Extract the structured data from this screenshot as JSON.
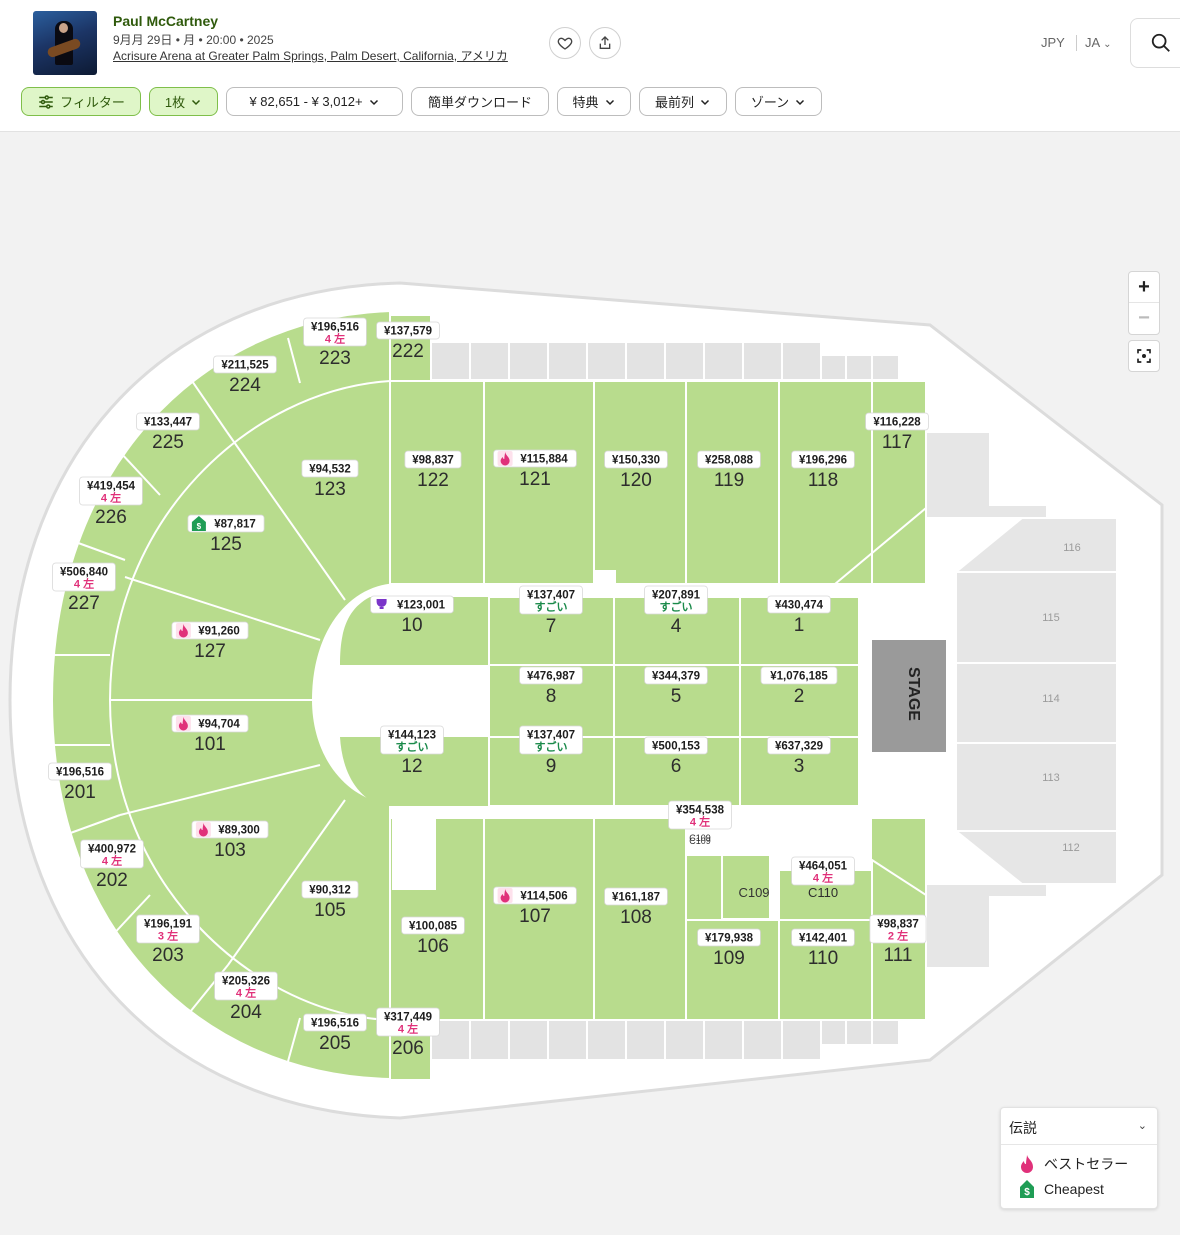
{
  "event": {
    "title": "Paul McCartney",
    "date_line": "9月月 29日 • 月 • 20:00 • 2025",
    "venue": "Acrisure Arena at Greater Palm Springs, Palm Desert, California, アメリカ"
  },
  "header": {
    "currency": "JPY",
    "language": "JA"
  },
  "filters": {
    "filter_label": "フィルター",
    "quantity_label": "1枚",
    "price_label": "¥ 82,651 - ¥ 3,012+",
    "instant_download_label": "簡単ダウンロード",
    "perks_label": "特典",
    "front_row_label": "最前列",
    "zone_label": "ゾーン"
  },
  "map": {
    "stage_label": "STAGE",
    "zoom_in": "+",
    "zoom_out": "−",
    "sections": [
      {
        "id": "223",
        "price": "¥196,516",
        "note": "4 左"
      },
      {
        "id": "222",
        "price": "¥137,579",
        "note": ""
      },
      {
        "id": "224",
        "price": "¥211,525",
        "note": ""
      },
      {
        "id": "225",
        "price": "¥133,447",
        "note": ""
      },
      {
        "id": "226",
        "price": "¥419,454",
        "note": "4 左"
      },
      {
        "id": "227",
        "price": "¥506,840",
        "note": "4 左"
      },
      {
        "id": "127",
        "price": "¥91,260",
        "note": ""
      },
      {
        "id": "101",
        "price": "¥94,704",
        "note": ""
      },
      {
        "id": "201",
        "price": "¥196,516",
        "note": ""
      },
      {
        "id": "202",
        "price": "¥400,972",
        "note": "4 左"
      },
      {
        "id": "103",
        "price": "¥89,300",
        "note": ""
      },
      {
        "id": "203",
        "price": "¥196,191",
        "note": "3 左"
      },
      {
        "id": "204",
        "price": "¥205,326",
        "note": "4 左"
      },
      {
        "id": "205",
        "price": "¥196,516",
        "note": ""
      },
      {
        "id": "206",
        "price": "¥317,449",
        "note": "4 左"
      },
      {
        "id": "105",
        "price": "¥90,312",
        "note": ""
      },
      {
        "id": "106",
        "price": "¥100,085",
        "note": ""
      },
      {
        "id": "107",
        "price": "¥114,506",
        "note": ""
      },
      {
        "id": "108",
        "price": "¥161,187",
        "note": ""
      },
      {
        "id": "109",
        "price": "¥179,938",
        "note": ""
      },
      {
        "id": "110",
        "price": "¥142,401",
        "note": ""
      },
      {
        "id": "111",
        "price": "¥98,837",
        "note": "2 左"
      },
      {
        "id": "C110",
        "price": "¥464,051",
        "note": "4 左"
      },
      {
        "id": "C109",
        "price": "¥354,538",
        "note": "4 左"
      },
      {
        "id": "123",
        "price": "¥94,532",
        "note": ""
      },
      {
        "id": "125",
        "price": "¥87,817",
        "note": ""
      },
      {
        "id": "122",
        "price": "¥98,837",
        "note": ""
      },
      {
        "id": "121",
        "price": "¥115,884",
        "note": ""
      },
      {
        "id": "120",
        "price": "¥150,330",
        "note": ""
      },
      {
        "id": "119",
        "price": "¥258,088",
        "note": ""
      },
      {
        "id": "118",
        "price": "¥196,296",
        "note": ""
      },
      {
        "id": "117",
        "price": "¥116,228",
        "note": ""
      },
      {
        "id": "10",
        "price": "¥123,001",
        "note": ""
      },
      {
        "id": "7",
        "price": "¥137,407",
        "note": "すごい"
      },
      {
        "id": "4",
        "price": "¥207,891",
        "note": "すごい"
      },
      {
        "id": "1",
        "price": "¥430,474",
        "note": ""
      },
      {
        "id": "8",
        "price": "¥476,987",
        "note": ""
      },
      {
        "id": "5",
        "price": "¥344,379",
        "note": ""
      },
      {
        "id": "2",
        "price": "¥1,076,185",
        "note": ""
      },
      {
        "id": "12",
        "price": "¥144,123",
        "note": "すごい"
      },
      {
        "id": "9",
        "price": "¥137,407",
        "note": "すごい"
      },
      {
        "id": "6",
        "price": "¥500,153",
        "note": ""
      },
      {
        "id": "3",
        "price": "¥637,329",
        "note": ""
      }
    ],
    "unavailable_sections": [
      "116",
      "115",
      "114",
      "113",
      "112"
    ],
    "floor_label_c109": "C109",
    "floor_label_c110": "C110"
  },
  "legend": {
    "title": "伝説",
    "items": [
      {
        "label": "ベストセラー",
        "icon": "fire-icon",
        "color": "#e0317a"
      },
      {
        "label": "Cheapest",
        "icon": "dollar-tag-icon",
        "color": "#1f9d55"
      }
    ]
  },
  "colors": {
    "section_green": "#b8dc8d",
    "brand_green": "#2f5a0c",
    "bestseller_pink": "#e0317a",
    "cheapest_green": "#1f9d55",
    "great_deal_green": "#1a8a4a",
    "stage_gray": "#9a9a9a"
  }
}
